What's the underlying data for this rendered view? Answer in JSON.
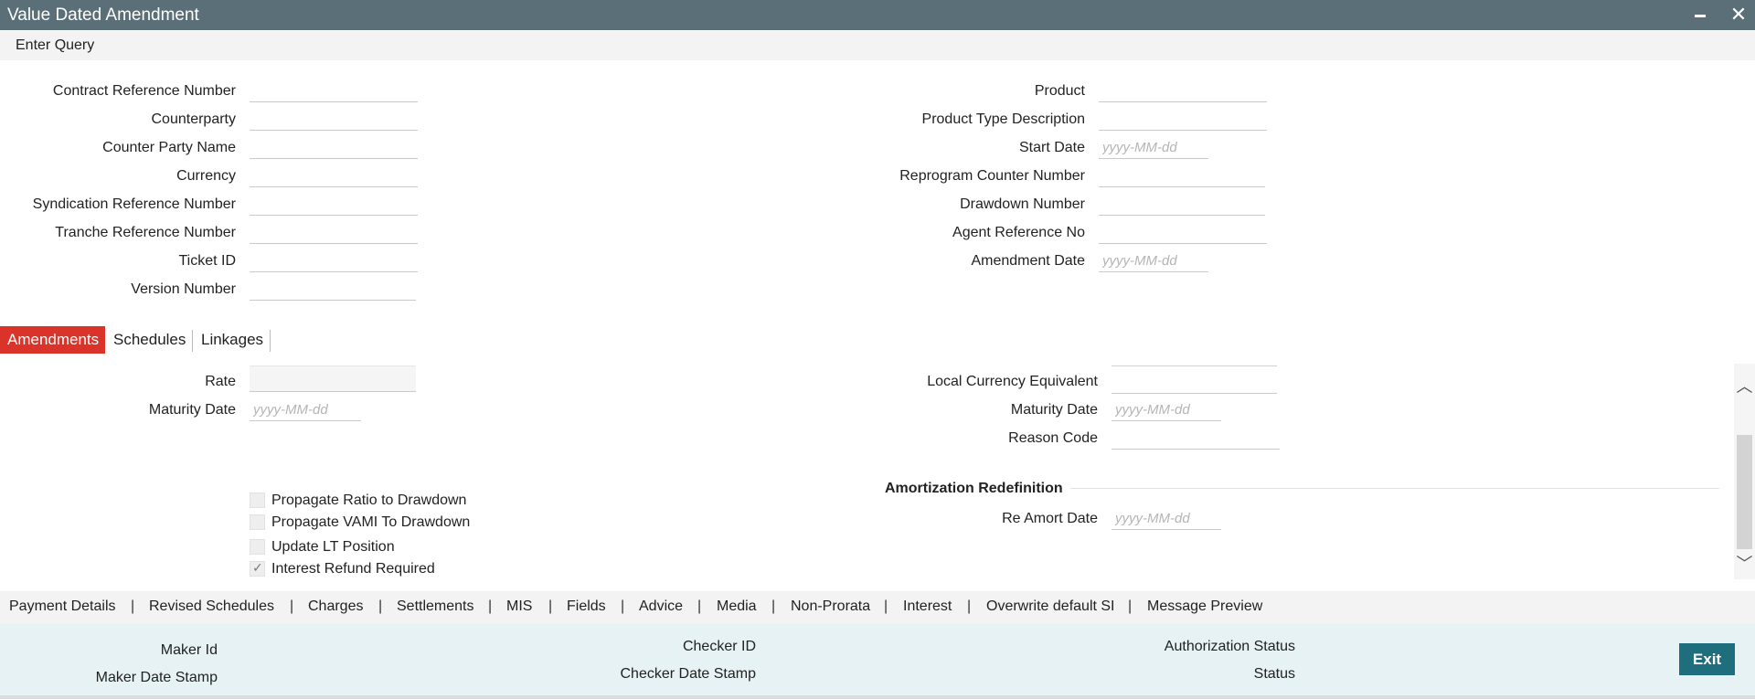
{
  "window": {
    "title": "Value Dated Amendment",
    "minimize_icon": "minimize-icon",
    "close_icon": "close-icon",
    "close_glyph": "✕"
  },
  "toolbar": {
    "enter_query": "Enter Query"
  },
  "header_fields": {
    "left": [
      {
        "label": "Contract Reference Number",
        "value": "",
        "placeholder": ""
      },
      {
        "label": "Counterparty",
        "value": "",
        "placeholder": ""
      },
      {
        "label": "Counter Party Name",
        "value": "",
        "placeholder": ""
      },
      {
        "label": "Currency",
        "value": "",
        "placeholder": ""
      },
      {
        "label": "Syndication Reference Number",
        "value": "",
        "placeholder": ""
      },
      {
        "label": "Tranche Reference Number",
        "value": "",
        "placeholder": ""
      },
      {
        "label": "Ticket ID",
        "value": "",
        "placeholder": ""
      },
      {
        "label": "Version Number",
        "value": "",
        "placeholder": ""
      }
    ],
    "right": [
      {
        "label": "Product",
        "value": "",
        "placeholder": ""
      },
      {
        "label": "Product Type Description",
        "value": "",
        "placeholder": ""
      },
      {
        "label": "Start Date",
        "value": "",
        "placeholder": "yyyy-MM-dd"
      },
      {
        "label": "Reprogram Counter Number",
        "value": "",
        "placeholder": ""
      },
      {
        "label": "Drawdown Number",
        "value": "",
        "placeholder": ""
      },
      {
        "label": "Agent Reference No",
        "value": "",
        "placeholder": ""
      },
      {
        "label": "Amendment Date",
        "value": "",
        "placeholder": "yyyy-MM-dd"
      }
    ]
  },
  "tabs": [
    {
      "label": "Amendments",
      "active": true
    },
    {
      "label": "Schedules",
      "active": false
    },
    {
      "label": "Linkages",
      "active": false
    }
  ],
  "amendments": {
    "left": [
      {
        "label": "Rate",
        "value": "",
        "placeholder": ""
      },
      {
        "label": "Maturity Date",
        "value": "",
        "placeholder": "yyyy-MM-dd"
      }
    ],
    "right": [
      {
        "label": "Local Currency Equivalent",
        "value": "",
        "placeholder": ""
      },
      {
        "label": "Maturity Date",
        "value": "",
        "placeholder": "yyyy-MM-dd"
      },
      {
        "label": "Reason Code",
        "value": "",
        "placeholder": ""
      }
    ],
    "checkboxes": [
      {
        "label": "Propagate Ratio to Drawdown",
        "checked": false
      },
      {
        "label": "Propagate VAMI To Drawdown",
        "checked": false
      },
      {
        "label": "Update LT Position",
        "checked": false
      },
      {
        "label": "Interest Refund Required",
        "checked": true
      }
    ],
    "amortization": {
      "title": "Amortization Redefinition",
      "re_amort_date": {
        "label": "Re Amort Date",
        "value": "",
        "placeholder": "yyyy-MM-dd"
      }
    }
  },
  "scrollbar": {
    "up_glyph": "︿",
    "down_glyph": "﹀"
  },
  "links": [
    "Payment Details",
    "Revised Schedules",
    "Charges",
    "Settlements",
    "MIS",
    "Fields",
    "Advice",
    "Media",
    "Non-Prorata",
    "Interest",
    "Overwrite default SI",
    "Message Preview"
  ],
  "link_separator": "|",
  "audit": {
    "maker_id": "Maker Id",
    "maker_date_stamp": "Maker Date Stamp",
    "checker_id": "Checker ID",
    "checker_date_stamp": "Checker Date Stamp",
    "authorization_status": "Authorization Status",
    "status": "Status"
  },
  "buttons": {
    "exit": "Exit"
  },
  "colors": {
    "titlebar": "#5a6f77",
    "active_tab": "#d9332a",
    "exit_button": "#1f6e7e",
    "footer": "#e6f2f3"
  }
}
